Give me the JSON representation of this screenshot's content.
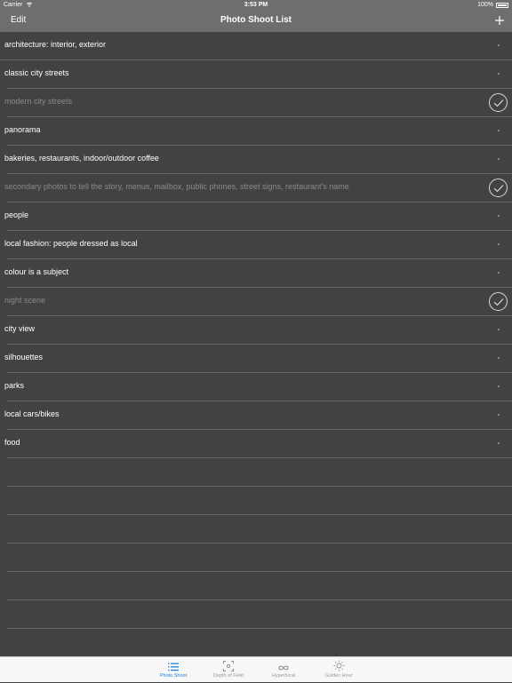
{
  "status_bar": {
    "carrier": "Carrier",
    "time": "3:53 PM",
    "battery": "100%"
  },
  "navbar": {
    "edit_label": "Edit",
    "title": "Photo Shoot List",
    "add_label": "+"
  },
  "list": {
    "items": [
      {
        "label": "architecture: interior, exterior",
        "done": false
      },
      {
        "label": "classic city streets",
        "done": false
      },
      {
        "label": "modern city streets",
        "done": true
      },
      {
        "label": "panorama",
        "done": false
      },
      {
        "label": "bakeries, restaurants, indoor/outdoor coffee",
        "done": false
      },
      {
        "label": "secondary photos to tell the story, menus, mailbox, public phones, street signs, restaurant's name",
        "done": true
      },
      {
        "label": "people",
        "done": false
      },
      {
        "label": "local fashion: people dressed as local",
        "done": false
      },
      {
        "label": "colour is a subject",
        "done": false
      },
      {
        "label": "night scene",
        "done": true
      },
      {
        "label": "city view",
        "done": false
      },
      {
        "label": "silhouettes",
        "done": false
      },
      {
        "label": "parks",
        "done": false
      },
      {
        "label": "local cars/bikes",
        "done": false
      },
      {
        "label": "food",
        "done": false
      }
    ],
    "empty_rows": 7
  },
  "tabbar": {
    "tabs": [
      {
        "label": "Photo Shoot",
        "icon": "list-icon",
        "active": true
      },
      {
        "label": "Depth of Field",
        "icon": "focus-frame-icon",
        "active": false
      },
      {
        "label": "Hyperfocal",
        "icon": "infinity-icon",
        "active": false
      },
      {
        "label": "Golden Hour",
        "icon": "sun-icon",
        "active": false
      }
    ],
    "active_color": "#2a7fd4"
  }
}
